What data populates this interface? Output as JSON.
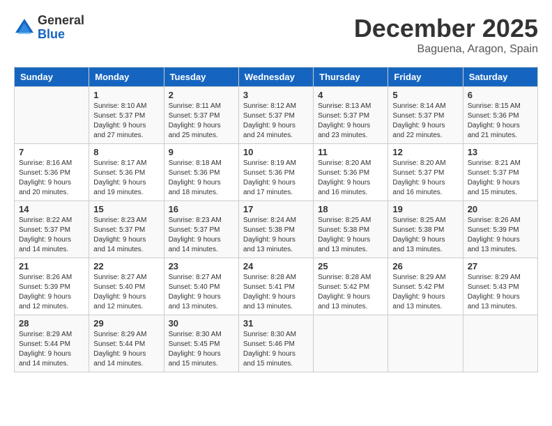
{
  "header": {
    "logo_general": "General",
    "logo_blue": "Blue",
    "month_title": "December 2025",
    "subtitle": "Baguena, Aragon, Spain"
  },
  "days_of_week": [
    "Sunday",
    "Monday",
    "Tuesday",
    "Wednesday",
    "Thursday",
    "Friday",
    "Saturday"
  ],
  "weeks": [
    [
      {
        "day": "",
        "sunrise": "",
        "sunset": "",
        "daylight": ""
      },
      {
        "day": "1",
        "sunrise": "Sunrise: 8:10 AM",
        "sunset": "Sunset: 5:37 PM",
        "daylight": "Daylight: 9 hours and 27 minutes."
      },
      {
        "day": "2",
        "sunrise": "Sunrise: 8:11 AM",
        "sunset": "Sunset: 5:37 PM",
        "daylight": "Daylight: 9 hours and 25 minutes."
      },
      {
        "day": "3",
        "sunrise": "Sunrise: 8:12 AM",
        "sunset": "Sunset: 5:37 PM",
        "daylight": "Daylight: 9 hours and 24 minutes."
      },
      {
        "day": "4",
        "sunrise": "Sunrise: 8:13 AM",
        "sunset": "Sunset: 5:37 PM",
        "daylight": "Daylight: 9 hours and 23 minutes."
      },
      {
        "day": "5",
        "sunrise": "Sunrise: 8:14 AM",
        "sunset": "Sunset: 5:37 PM",
        "daylight": "Daylight: 9 hours and 22 minutes."
      },
      {
        "day": "6",
        "sunrise": "Sunrise: 8:15 AM",
        "sunset": "Sunset: 5:36 PM",
        "daylight": "Daylight: 9 hours and 21 minutes."
      }
    ],
    [
      {
        "day": "7",
        "sunrise": "Sunrise: 8:16 AM",
        "sunset": "Sunset: 5:36 PM",
        "daylight": "Daylight: 9 hours and 20 minutes."
      },
      {
        "day": "8",
        "sunrise": "Sunrise: 8:17 AM",
        "sunset": "Sunset: 5:36 PM",
        "daylight": "Daylight: 9 hours and 19 minutes."
      },
      {
        "day": "9",
        "sunrise": "Sunrise: 8:18 AM",
        "sunset": "Sunset: 5:36 PM",
        "daylight": "Daylight: 9 hours and 18 minutes."
      },
      {
        "day": "10",
        "sunrise": "Sunrise: 8:19 AM",
        "sunset": "Sunset: 5:36 PM",
        "daylight": "Daylight: 9 hours and 17 minutes."
      },
      {
        "day": "11",
        "sunrise": "Sunrise: 8:20 AM",
        "sunset": "Sunset: 5:36 PM",
        "daylight": "Daylight: 9 hours and 16 minutes."
      },
      {
        "day": "12",
        "sunrise": "Sunrise: 8:20 AM",
        "sunset": "Sunset: 5:37 PM",
        "daylight": "Daylight: 9 hours and 16 minutes."
      },
      {
        "day": "13",
        "sunrise": "Sunrise: 8:21 AM",
        "sunset": "Sunset: 5:37 PM",
        "daylight": "Daylight: 9 hours and 15 minutes."
      }
    ],
    [
      {
        "day": "14",
        "sunrise": "Sunrise: 8:22 AM",
        "sunset": "Sunset: 5:37 PM",
        "daylight": "Daylight: 9 hours and 14 minutes."
      },
      {
        "day": "15",
        "sunrise": "Sunrise: 8:23 AM",
        "sunset": "Sunset: 5:37 PM",
        "daylight": "Daylight: 9 hours and 14 minutes."
      },
      {
        "day": "16",
        "sunrise": "Sunrise: 8:23 AM",
        "sunset": "Sunset: 5:37 PM",
        "daylight": "Daylight: 9 hours and 14 minutes."
      },
      {
        "day": "17",
        "sunrise": "Sunrise: 8:24 AM",
        "sunset": "Sunset: 5:38 PM",
        "daylight": "Daylight: 9 hours and 13 minutes."
      },
      {
        "day": "18",
        "sunrise": "Sunrise: 8:25 AM",
        "sunset": "Sunset: 5:38 PM",
        "daylight": "Daylight: 9 hours and 13 minutes."
      },
      {
        "day": "19",
        "sunrise": "Sunrise: 8:25 AM",
        "sunset": "Sunset: 5:38 PM",
        "daylight": "Daylight: 9 hours and 13 minutes."
      },
      {
        "day": "20",
        "sunrise": "Sunrise: 8:26 AM",
        "sunset": "Sunset: 5:39 PM",
        "daylight": "Daylight: 9 hours and 13 minutes."
      }
    ],
    [
      {
        "day": "21",
        "sunrise": "Sunrise: 8:26 AM",
        "sunset": "Sunset: 5:39 PM",
        "daylight": "Daylight: 9 hours and 12 minutes."
      },
      {
        "day": "22",
        "sunrise": "Sunrise: 8:27 AM",
        "sunset": "Sunset: 5:40 PM",
        "daylight": "Daylight: 9 hours and 12 minutes."
      },
      {
        "day": "23",
        "sunrise": "Sunrise: 8:27 AM",
        "sunset": "Sunset: 5:40 PM",
        "daylight": "Daylight: 9 hours and 13 minutes."
      },
      {
        "day": "24",
        "sunrise": "Sunrise: 8:28 AM",
        "sunset": "Sunset: 5:41 PM",
        "daylight": "Daylight: 9 hours and 13 minutes."
      },
      {
        "day": "25",
        "sunrise": "Sunrise: 8:28 AM",
        "sunset": "Sunset: 5:42 PM",
        "daylight": "Daylight: 9 hours and 13 minutes."
      },
      {
        "day": "26",
        "sunrise": "Sunrise: 8:29 AM",
        "sunset": "Sunset: 5:42 PM",
        "daylight": "Daylight: 9 hours and 13 minutes."
      },
      {
        "day": "27",
        "sunrise": "Sunrise: 8:29 AM",
        "sunset": "Sunset: 5:43 PM",
        "daylight": "Daylight: 9 hours and 13 minutes."
      }
    ],
    [
      {
        "day": "28",
        "sunrise": "Sunrise: 8:29 AM",
        "sunset": "Sunset: 5:44 PM",
        "daylight": "Daylight: 9 hours and 14 minutes."
      },
      {
        "day": "29",
        "sunrise": "Sunrise: 8:29 AM",
        "sunset": "Sunset: 5:44 PM",
        "daylight": "Daylight: 9 hours and 14 minutes."
      },
      {
        "day": "30",
        "sunrise": "Sunrise: 8:30 AM",
        "sunset": "Sunset: 5:45 PM",
        "daylight": "Daylight: 9 hours and 15 minutes."
      },
      {
        "day": "31",
        "sunrise": "Sunrise: 8:30 AM",
        "sunset": "Sunset: 5:46 PM",
        "daylight": "Daylight: 9 hours and 15 minutes."
      },
      {
        "day": "",
        "sunrise": "",
        "sunset": "",
        "daylight": ""
      },
      {
        "day": "",
        "sunrise": "",
        "sunset": "",
        "daylight": ""
      },
      {
        "day": "",
        "sunrise": "",
        "sunset": "",
        "daylight": ""
      }
    ]
  ]
}
